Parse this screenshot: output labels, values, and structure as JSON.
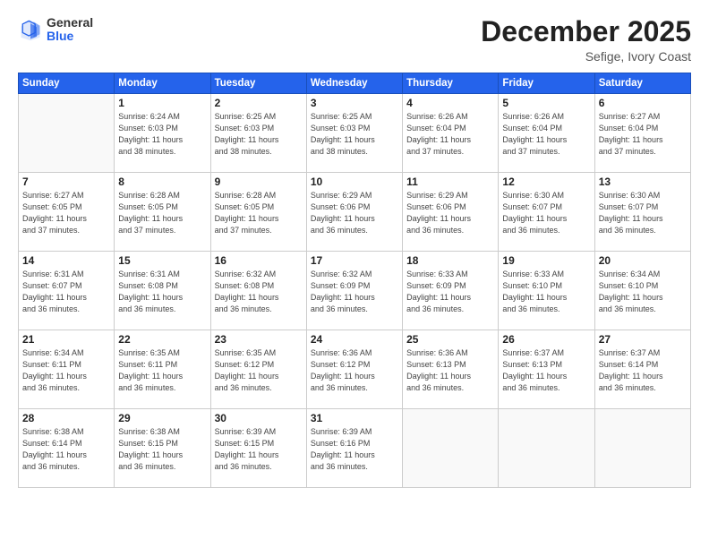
{
  "header": {
    "logo_general": "General",
    "logo_blue": "Blue",
    "month": "December 2025",
    "location": "Sefige, Ivory Coast"
  },
  "weekdays": [
    "Sunday",
    "Monday",
    "Tuesday",
    "Wednesday",
    "Thursday",
    "Friday",
    "Saturday"
  ],
  "weeks": [
    [
      {
        "day": "",
        "info": ""
      },
      {
        "day": "1",
        "info": "Sunrise: 6:24 AM\nSunset: 6:03 PM\nDaylight: 11 hours\nand 38 minutes."
      },
      {
        "day": "2",
        "info": "Sunrise: 6:25 AM\nSunset: 6:03 PM\nDaylight: 11 hours\nand 38 minutes."
      },
      {
        "day": "3",
        "info": "Sunrise: 6:25 AM\nSunset: 6:03 PM\nDaylight: 11 hours\nand 38 minutes."
      },
      {
        "day": "4",
        "info": "Sunrise: 6:26 AM\nSunset: 6:04 PM\nDaylight: 11 hours\nand 37 minutes."
      },
      {
        "day": "5",
        "info": "Sunrise: 6:26 AM\nSunset: 6:04 PM\nDaylight: 11 hours\nand 37 minutes."
      },
      {
        "day": "6",
        "info": "Sunrise: 6:27 AM\nSunset: 6:04 PM\nDaylight: 11 hours\nand 37 minutes."
      }
    ],
    [
      {
        "day": "7",
        "info": "Sunrise: 6:27 AM\nSunset: 6:05 PM\nDaylight: 11 hours\nand 37 minutes."
      },
      {
        "day": "8",
        "info": "Sunrise: 6:28 AM\nSunset: 6:05 PM\nDaylight: 11 hours\nand 37 minutes."
      },
      {
        "day": "9",
        "info": "Sunrise: 6:28 AM\nSunset: 6:05 PM\nDaylight: 11 hours\nand 37 minutes."
      },
      {
        "day": "10",
        "info": "Sunrise: 6:29 AM\nSunset: 6:06 PM\nDaylight: 11 hours\nand 36 minutes."
      },
      {
        "day": "11",
        "info": "Sunrise: 6:29 AM\nSunset: 6:06 PM\nDaylight: 11 hours\nand 36 minutes."
      },
      {
        "day": "12",
        "info": "Sunrise: 6:30 AM\nSunset: 6:07 PM\nDaylight: 11 hours\nand 36 minutes."
      },
      {
        "day": "13",
        "info": "Sunrise: 6:30 AM\nSunset: 6:07 PM\nDaylight: 11 hours\nand 36 minutes."
      }
    ],
    [
      {
        "day": "14",
        "info": "Sunrise: 6:31 AM\nSunset: 6:07 PM\nDaylight: 11 hours\nand 36 minutes."
      },
      {
        "day": "15",
        "info": "Sunrise: 6:31 AM\nSunset: 6:08 PM\nDaylight: 11 hours\nand 36 minutes."
      },
      {
        "day": "16",
        "info": "Sunrise: 6:32 AM\nSunset: 6:08 PM\nDaylight: 11 hours\nand 36 minutes."
      },
      {
        "day": "17",
        "info": "Sunrise: 6:32 AM\nSunset: 6:09 PM\nDaylight: 11 hours\nand 36 minutes."
      },
      {
        "day": "18",
        "info": "Sunrise: 6:33 AM\nSunset: 6:09 PM\nDaylight: 11 hours\nand 36 minutes."
      },
      {
        "day": "19",
        "info": "Sunrise: 6:33 AM\nSunset: 6:10 PM\nDaylight: 11 hours\nand 36 minutes."
      },
      {
        "day": "20",
        "info": "Sunrise: 6:34 AM\nSunset: 6:10 PM\nDaylight: 11 hours\nand 36 minutes."
      }
    ],
    [
      {
        "day": "21",
        "info": "Sunrise: 6:34 AM\nSunset: 6:11 PM\nDaylight: 11 hours\nand 36 minutes."
      },
      {
        "day": "22",
        "info": "Sunrise: 6:35 AM\nSunset: 6:11 PM\nDaylight: 11 hours\nand 36 minutes."
      },
      {
        "day": "23",
        "info": "Sunrise: 6:35 AM\nSunset: 6:12 PM\nDaylight: 11 hours\nand 36 minutes."
      },
      {
        "day": "24",
        "info": "Sunrise: 6:36 AM\nSunset: 6:12 PM\nDaylight: 11 hours\nand 36 minutes."
      },
      {
        "day": "25",
        "info": "Sunrise: 6:36 AM\nSunset: 6:13 PM\nDaylight: 11 hours\nand 36 minutes."
      },
      {
        "day": "26",
        "info": "Sunrise: 6:37 AM\nSunset: 6:13 PM\nDaylight: 11 hours\nand 36 minutes."
      },
      {
        "day": "27",
        "info": "Sunrise: 6:37 AM\nSunset: 6:14 PM\nDaylight: 11 hours\nand 36 minutes."
      }
    ],
    [
      {
        "day": "28",
        "info": "Sunrise: 6:38 AM\nSunset: 6:14 PM\nDaylight: 11 hours\nand 36 minutes."
      },
      {
        "day": "29",
        "info": "Sunrise: 6:38 AM\nSunset: 6:15 PM\nDaylight: 11 hours\nand 36 minutes."
      },
      {
        "day": "30",
        "info": "Sunrise: 6:39 AM\nSunset: 6:15 PM\nDaylight: 11 hours\nand 36 minutes."
      },
      {
        "day": "31",
        "info": "Sunrise: 6:39 AM\nSunset: 6:16 PM\nDaylight: 11 hours\nand 36 minutes."
      },
      {
        "day": "",
        "info": ""
      },
      {
        "day": "",
        "info": ""
      },
      {
        "day": "",
        "info": ""
      }
    ]
  ]
}
